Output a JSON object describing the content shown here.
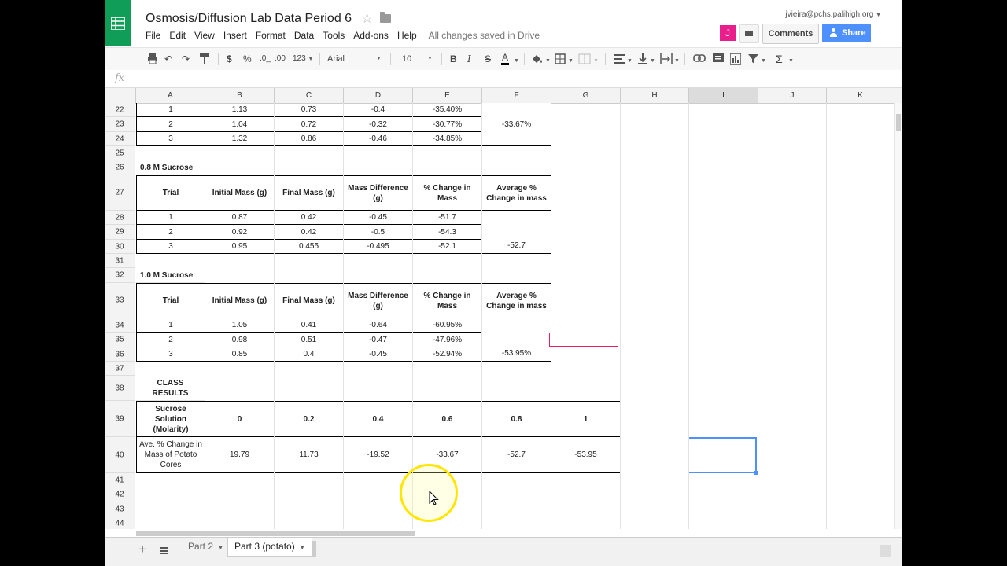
{
  "header": {
    "title": "Osmosis/Diffusion Lab Data Period 6",
    "account": "jvieira@pchs.palihigh.org",
    "avatar_letter": "J",
    "comments_label": "Comments",
    "share_label": "Share",
    "brand_color": "#0f9d58"
  },
  "menu": {
    "items": [
      "File",
      "Edit",
      "View",
      "Insert",
      "Format",
      "Data",
      "Tools",
      "Add-ons",
      "Help"
    ],
    "status": "All changes saved in Drive"
  },
  "toolbar": {
    "currency": "$",
    "percent": "%",
    "dec_less": ".0_",
    "dec_more": ".00",
    "more_formats": "123",
    "font": "Arial",
    "font_size": "10",
    "bold": "B",
    "italic": "I",
    "strike": "S",
    "text_color": "A",
    "sum": "Σ"
  },
  "formula_bar": {
    "fx": "fx",
    "value": ""
  },
  "columns": [
    "A",
    "B",
    "C",
    "D",
    "E",
    "F",
    "G",
    "H",
    "I",
    "J",
    "K"
  ],
  "selected_column": "I",
  "rows": [
    {
      "n": "22",
      "cells": [
        "1",
        "1.13",
        "0.73",
        "-0.4",
        "-35.40%",
        ""
      ]
    },
    {
      "n": "23",
      "cells": [
        "2",
        "1.04",
        "0.72",
        "-0.32",
        "-30.77%",
        "-33.67%"
      ]
    },
    {
      "n": "24",
      "cells": [
        "3",
        "1.32",
        "0.86",
        "-0.46",
        "-34.85%",
        ""
      ]
    },
    {
      "n": "25",
      "cells": []
    },
    {
      "n": "26",
      "cells": [
        "0.8 M Sucrose"
      ]
    },
    {
      "n": "27",
      "cells": [
        "Trial",
        "Initial Mass (g)",
        "Final Mass (g)",
        "Mass Difference (g)",
        "% Change in Mass",
        "Average % Change in mass"
      ]
    },
    {
      "n": "28",
      "cells": [
        "1",
        "0.87",
        "0.42",
        "-0.45",
        "-51.7",
        ""
      ]
    },
    {
      "n": "29",
      "cells": [
        "2",
        "0.92",
        "0.42",
        "-0.5",
        "-54.3",
        ""
      ]
    },
    {
      "n": "30",
      "cells": [
        "3",
        "0.95",
        "0.455",
        "-0.495",
        "-52.1",
        "-52.7"
      ]
    },
    {
      "n": "31",
      "cells": []
    },
    {
      "n": "32",
      "cells": [
        "1.0 M Sucrose"
      ]
    },
    {
      "n": "33",
      "cells": [
        "Trial",
        "Initial Mass (g)",
        "Final Mass (g)",
        "Mass Difference (g)",
        "% Change in Mass",
        "Average % Change in mass"
      ]
    },
    {
      "n": "34",
      "cells": [
        "1",
        "1.05",
        "0.41",
        "-0.64",
        "-60.95%",
        ""
      ]
    },
    {
      "n": "35",
      "cells": [
        "2",
        "0.98",
        "0.51",
        "-0.47",
        "-47.96%",
        ""
      ]
    },
    {
      "n": "36",
      "cells": [
        "3",
        "0.85",
        "0.4",
        "-0.45",
        "-52.94%",
        "-53.95%"
      ]
    },
    {
      "n": "37",
      "cells": []
    },
    {
      "n": "38",
      "cells": [
        "CLASS RESULTS"
      ]
    },
    {
      "n": "39",
      "cells": [
        "Sucrose Solution (Molarity)",
        "0",
        "0.2",
        "0.4",
        "0.6",
        "0.8",
        "1"
      ]
    },
    {
      "n": "40",
      "cells": [
        "Ave. % Change in Mass of Potato Cores",
        "19.79",
        "11.73",
        "-19.52",
        "-33.67",
        "-52.7",
        "-53.95"
      ]
    },
    {
      "n": "41",
      "cells": []
    },
    {
      "n": "42",
      "cells": []
    },
    {
      "n": "43",
      "cells": []
    },
    {
      "n": "44",
      "cells": []
    }
  ],
  "sheets": {
    "tabs": [
      "Part 2",
      "Part 3 (potato)"
    ],
    "active": "Part 3 (potato)"
  }
}
